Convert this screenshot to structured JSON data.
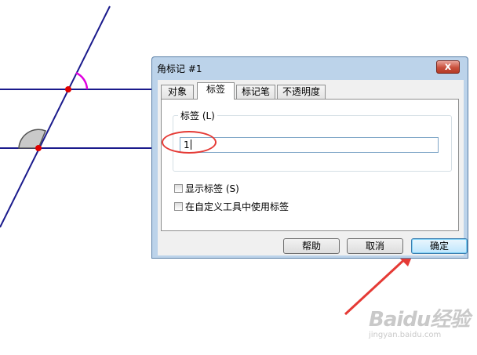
{
  "dialog": {
    "title": "角标记 #1",
    "close_glyph": "x",
    "tabs": [
      {
        "label": "对象"
      },
      {
        "label": "标签"
      },
      {
        "label": "标记笔"
      },
      {
        "label": "不透明度"
      }
    ],
    "active_tab": "标签",
    "label_group": {
      "title": "标签 (L)",
      "input_value": "1"
    },
    "checkboxes": [
      {
        "label": "显示标签 (S)",
        "checked": false
      },
      {
        "label": "在自定义工具中使用标签",
        "checked": false
      }
    ],
    "buttons": {
      "help": "帮助",
      "cancel": "取消",
      "ok": "确定"
    }
  },
  "colors": {
    "lines": "#1a1a8c",
    "points": "#e00000",
    "angle_marker": "#e000e0",
    "annotation": "#e53a35"
  },
  "watermark": {
    "brand": "Baidu经验",
    "url": "jingyan.baidu.com"
  }
}
